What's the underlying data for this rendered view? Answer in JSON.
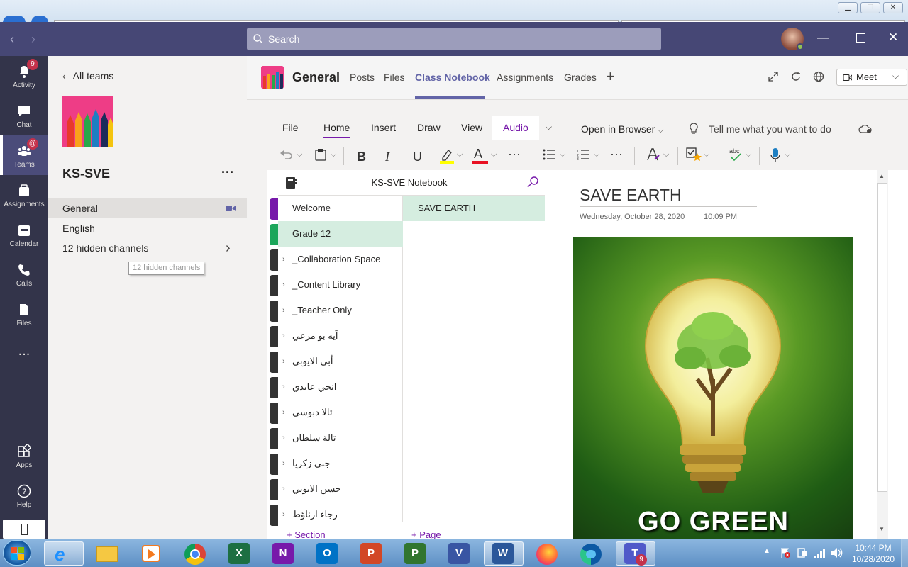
{
  "search": {
    "placeholder": "Search"
  },
  "rail": {
    "items": [
      {
        "label": "Activity",
        "badge": "9"
      },
      {
        "label": "Chat"
      },
      {
        "label": "Teams",
        "badge": "@"
      },
      {
        "label": "Assignments"
      },
      {
        "label": "Calendar"
      },
      {
        "label": "Calls"
      },
      {
        "label": "Files"
      },
      {
        "label": "..."
      },
      {
        "label": "Apps"
      },
      {
        "label": "Help"
      }
    ]
  },
  "teampanel": {
    "back_label": "All teams",
    "team_name": "KS-SVE",
    "more": "···",
    "channels": [
      "General",
      "English",
      "12 hidden channels"
    ],
    "tooltip": "12 hidden channels"
  },
  "header": {
    "channel": "General",
    "tabs": [
      "Posts",
      "Files",
      "Class Notebook",
      "Assignments",
      "Grades"
    ],
    "add": "+",
    "meet": "Meet"
  },
  "ribbon": {
    "tabs": [
      "File",
      "Home",
      "Insert",
      "Draw",
      "View",
      "Audio"
    ],
    "open_browser": "Open in Browser",
    "tell_me": "Tell me what you want to do",
    "tools": [
      "B",
      "I",
      "U",
      "A",
      "···",
      "···"
    ]
  },
  "notebook": {
    "name": "KS-SVE Notebook",
    "sections": [
      "Welcome",
      "Grade 12",
      "_Collaboration Space",
      "_Content Library",
      "_Teacher Only",
      "آيه بو مرعي",
      "أبي الايوبي",
      "انجي عابدي",
      "تالا دبوسي",
      "تالة سلطان",
      "جنى زكريا",
      "حسن الايوبي",
      "رجاء ارناؤط"
    ],
    "add_section": "+ Section",
    "pages": [
      "SAVE EARTH"
    ],
    "add_page": "+ Page"
  },
  "page": {
    "title": "SAVE EARTH",
    "date": "Wednesday, October 28, 2020",
    "time": "10:09 PM",
    "image_text": "GO GREEN"
  },
  "taskbar": {
    "time": "10:44 PM",
    "date": "10/28/2020",
    "apps": [
      "X",
      "N",
      "O",
      "P",
      "P",
      "V",
      "W",
      "T"
    ],
    "teams_badge": "9"
  },
  "colors": {
    "teams_purple": "#464775",
    "rail": "#33344a",
    "accent": "#6264a7",
    "onenote": "#7719aa",
    "green_section": "#d5ede0"
  }
}
